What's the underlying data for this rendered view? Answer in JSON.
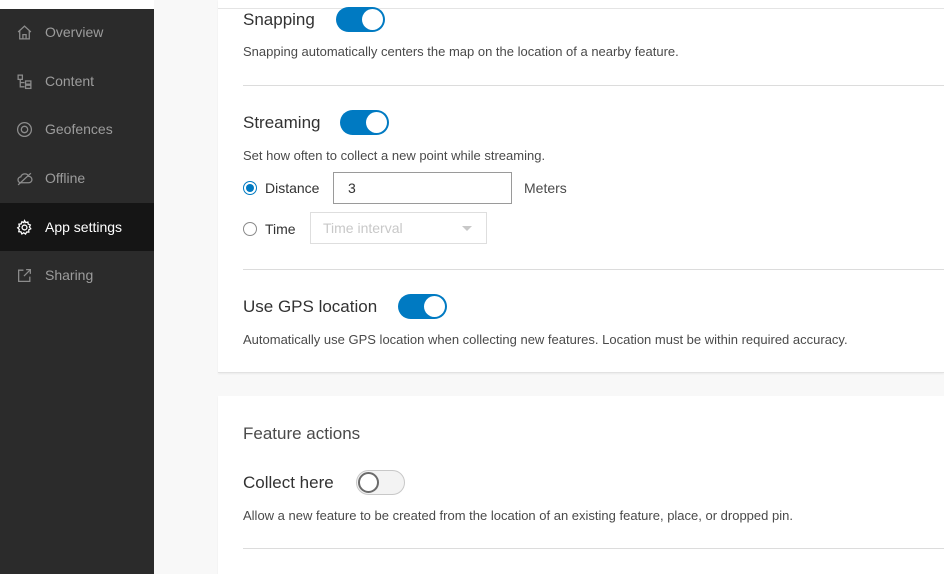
{
  "sidebar": {
    "items": [
      {
        "label": "Overview",
        "icon": "home-icon",
        "active": false
      },
      {
        "label": "Content",
        "icon": "content-tree-icon",
        "active": false
      },
      {
        "label": "Geofences",
        "icon": "geofence-icon",
        "active": false
      },
      {
        "label": "Offline",
        "icon": "offline-cloud-icon",
        "active": false
      },
      {
        "label": "App settings",
        "icon": "gear-icon",
        "active": true
      },
      {
        "label": "Sharing",
        "icon": "share-icon",
        "active": false
      }
    ]
  },
  "settings": {
    "snapping": {
      "label": "Snapping",
      "enabled": true,
      "description": "Snapping automatically centers the map on the location of a nearby feature."
    },
    "streaming": {
      "label": "Streaming",
      "enabled": true,
      "description": "Set how often to collect a new point while streaming.",
      "distance_label": "Distance",
      "distance_value": "3",
      "distance_unit": "Meters",
      "distance_selected": true,
      "time_label": "Time",
      "time_placeholder": "Time interval",
      "time_selected": false
    },
    "gps": {
      "label": "Use GPS location",
      "enabled": true,
      "description": "Automatically use GPS location when collecting new features. Location must be within required accuracy."
    }
  },
  "feature_actions": {
    "title": "Feature actions",
    "collect_here": {
      "label": "Collect here",
      "enabled": false,
      "description": "Allow a new feature to be created from the location of an existing feature, place, or dropped pin."
    }
  },
  "colors": {
    "accent": "#007ac2",
    "sidebar_bg": "#2b2b2b",
    "sidebar_active_bg": "#151515"
  }
}
